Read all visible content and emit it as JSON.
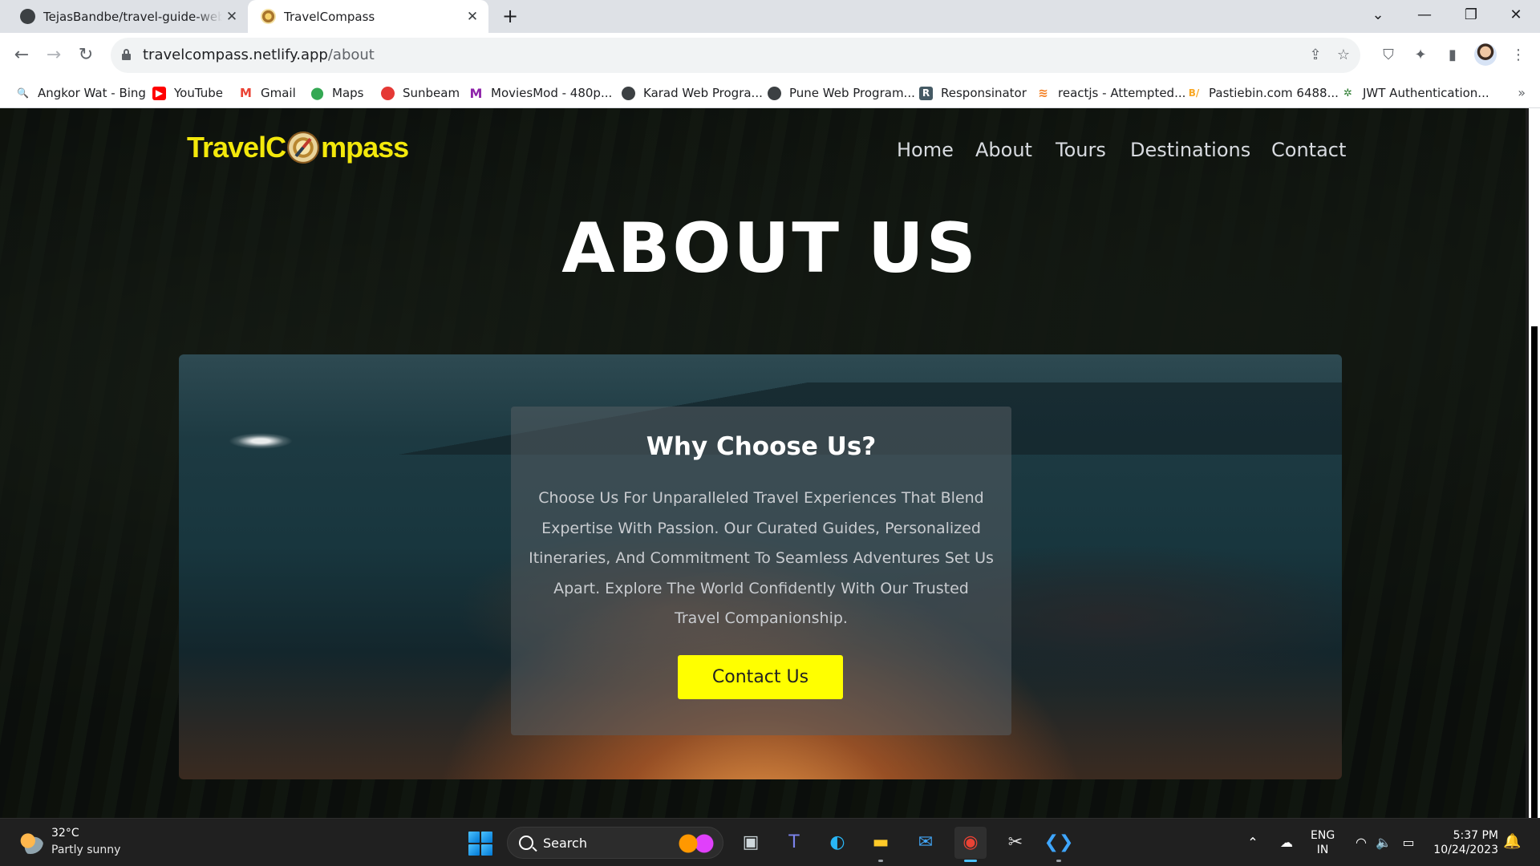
{
  "browser": {
    "tabs": [
      {
        "title": "TejasBandbe/travel-guide-website",
        "active": false
      },
      {
        "title": "TravelCompass",
        "active": true
      }
    ],
    "new_tab_icon": "+",
    "window_controls": {
      "dropdown": "⌄",
      "minimize": "—",
      "restore": "❐",
      "close": "✕"
    },
    "url_host": "travelcompass.netlify.app",
    "url_path": "/about",
    "bookmarks": [
      {
        "label": "Angkor Wat - Bing",
        "icon": "bing-icon",
        "color": "#1a73e8"
      },
      {
        "label": "YouTube",
        "icon": "youtube-icon",
        "color": "#ff0000"
      },
      {
        "label": "Gmail",
        "icon": "gmail-icon",
        "color": "#ea4335"
      },
      {
        "label": "Maps",
        "icon": "maps-icon",
        "color": "#34a853"
      },
      {
        "label": "Sunbeam",
        "icon": "sunbeam-icon",
        "color": "#e53935"
      },
      {
        "label": "MoviesMod - 480p...",
        "icon": "moviesmod-icon",
        "color": "#8e24aa"
      },
      {
        "label": "Karad Web Progra...",
        "icon": "globe-icon",
        "color": "#3c4043"
      },
      {
        "label": "Pune Web Program...",
        "icon": "globe-icon",
        "color": "#3c4043"
      },
      {
        "label": "Responsinator",
        "icon": "responsinator-icon",
        "color": "#455a64"
      },
      {
        "label": "reactjs - Attempted...",
        "icon": "stackoverflow-icon",
        "color": "#f48024"
      },
      {
        "label": "Pastiebin.com 6488...",
        "icon": "pastiebin-icon",
        "color": "#f9a825"
      },
      {
        "label": "JWT Authentication...",
        "icon": "jwt-icon",
        "color": "#2e7d32"
      }
    ],
    "bookmarks_more": "»"
  },
  "site": {
    "logo_pre": "TravelC",
    "logo_post": "mpass",
    "nav": [
      "Home",
      "About",
      "Tours",
      "Destinations",
      "Contact"
    ],
    "page_title": "ABOUT US",
    "why_title": "Why Choose Us?",
    "why_text": "Choose Us For Unparalleled Travel Experiences That Blend Expertise With Passion. Our Curated Guides, Personalized Itineraries, And Commitment To Seamless Adventures Set Us Apart. Explore The World Confidently With Our Trusted Travel Companionship.",
    "contact_button": "Contact Us",
    "accent_color": "#ffff00"
  },
  "taskbar": {
    "weather_temp": "32°C",
    "weather_desc": "Partly sunny",
    "search_label": "Search",
    "lang_top": "ENG",
    "lang_bottom": "IN",
    "time": "5:37 PM",
    "date": "10/24/2023"
  }
}
